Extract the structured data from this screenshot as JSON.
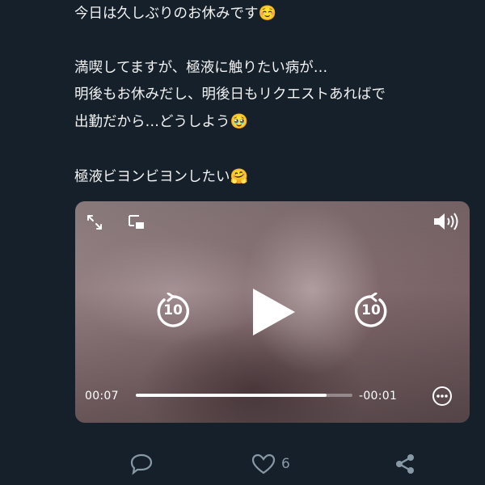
{
  "post": {
    "lines": [
      "今日は久しぶりのお休みです",
      "",
      "満喫してますが、極液に触りたい病が…",
      "明後もお休みだし、明後日もリクエストあればで",
      "出勤だから…どうしよう",
      "",
      "極液ビヨンビヨンしたい"
    ],
    "emoji_1": "☺️",
    "emoji_2": "🥹",
    "emoji_3": "🤗"
  },
  "video": {
    "elapsed": "00:07",
    "remaining": "-00:01",
    "progress": 0.88,
    "icons": [
      "fullscreen-icon",
      "picture-in-picture-icon",
      "volume-icon",
      "rewind-10-icon",
      "play-icon",
      "forward-10-icon",
      "more-icon"
    ],
    "rewind_label": "10",
    "forward_label": "10"
  },
  "actions": {
    "like_count": "6"
  },
  "colors": {
    "background": "#15202b",
    "text": "#f2f2f2",
    "muted": "#8899a6"
  }
}
